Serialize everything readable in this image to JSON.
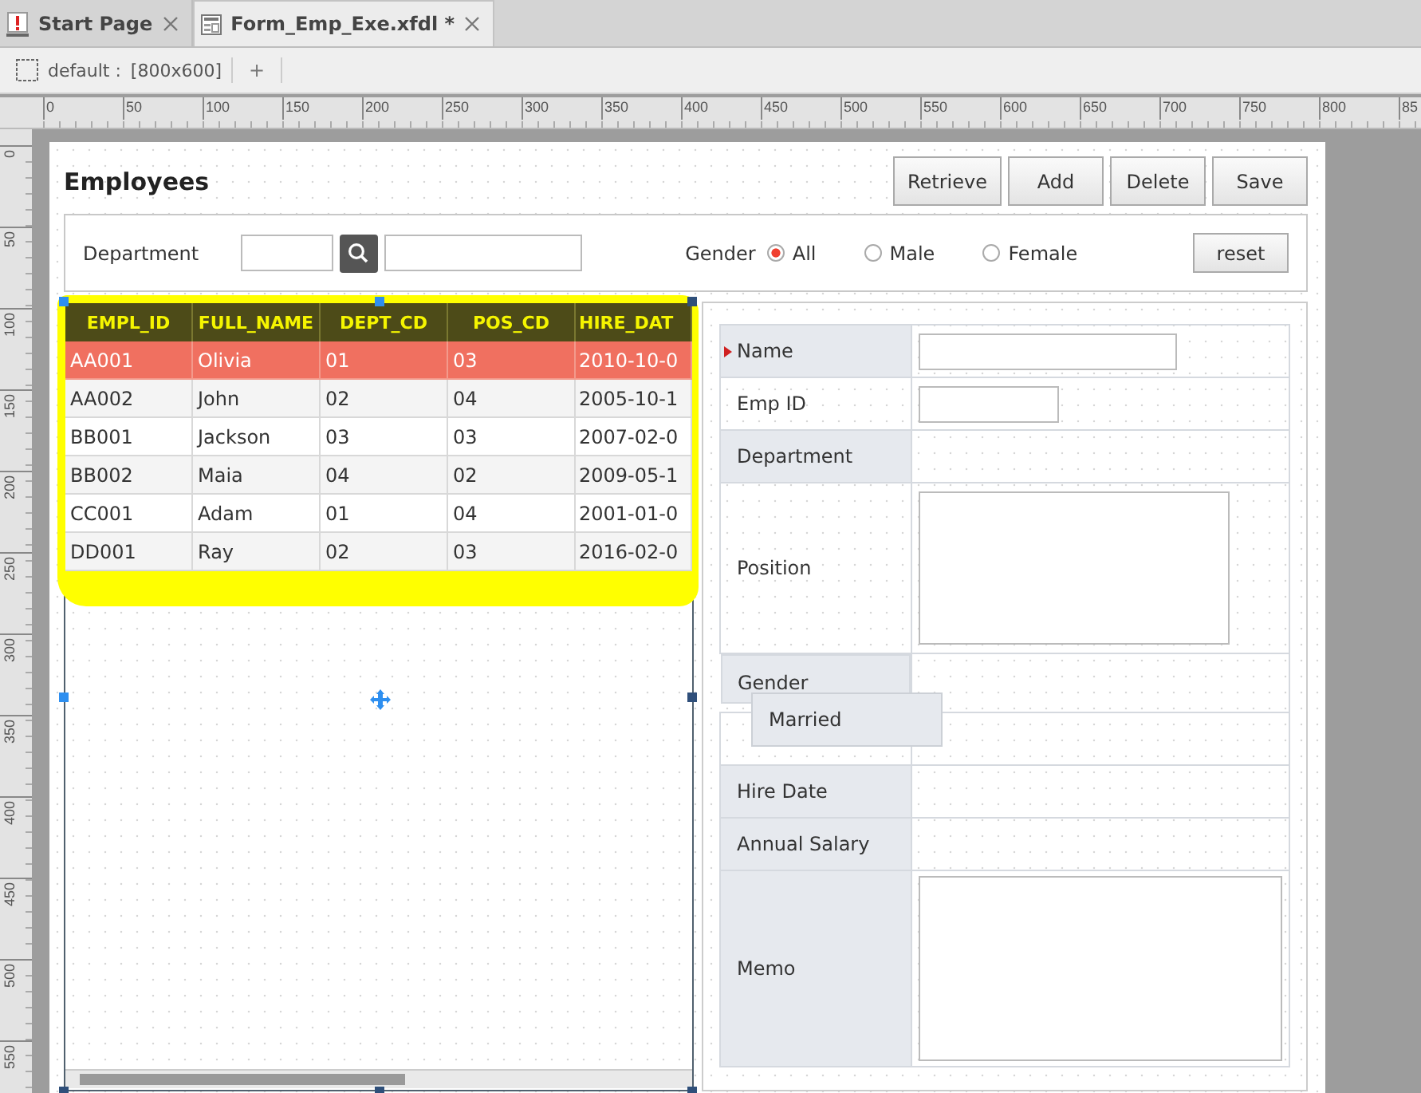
{
  "tabs": [
    {
      "label": "Start Page",
      "selected": false,
      "kind": "start"
    },
    {
      "label": "Form_Emp_Exe.xfdl *",
      "selected": true,
      "kind": "form"
    }
  ],
  "toolbar": {
    "layout_label": "default :",
    "layout_size": "[800x600]",
    "add": "+"
  },
  "rulers": {
    "horizontal": [
      "0",
      "50",
      "100",
      "150",
      "200",
      "250",
      "300",
      "350",
      "400",
      "450",
      "500",
      "550",
      "600",
      "650",
      "700",
      "750",
      "800",
      "85"
    ],
    "vertical": [
      "0",
      "50",
      "100",
      "150",
      "200",
      "250",
      "300",
      "350",
      "400",
      "450",
      "500",
      "550"
    ]
  },
  "form": {
    "title": "Employees",
    "buttons": [
      "Retrieve",
      "Add",
      "Delete",
      "Save"
    ],
    "search": {
      "department_label": "Department",
      "gender_label": "Gender",
      "gender_options": [
        {
          "label": "All",
          "selected": true
        },
        {
          "label": "Male",
          "selected": false
        },
        {
          "label": "Female",
          "selected": false
        }
      ],
      "reset": "reset"
    },
    "grid": {
      "columns": [
        "EMPL_ID",
        "FULL_NAME",
        "DEPT_CD",
        "POS_CD",
        "HIRE_DAT"
      ],
      "rows": [
        {
          "cells": [
            "AA001",
            "Olivia",
            "01",
            "03",
            "2010-10-0"
          ],
          "selected": true
        },
        {
          "cells": [
            "AA002",
            "John",
            "02",
            "04",
            "2005-10-1"
          ],
          "selected": false
        },
        {
          "cells": [
            "BB001",
            "Jackson",
            "03",
            "03",
            "2007-02-0"
          ],
          "selected": false
        },
        {
          "cells": [
            "BB002",
            "Maia",
            "04",
            "02",
            "2009-05-1"
          ],
          "selected": false
        },
        {
          "cells": [
            "CC001",
            "Adam",
            "01",
            "04",
            "2001-01-0"
          ],
          "selected": false
        },
        {
          "cells": [
            "DD001",
            "Ray",
            "02",
            "03",
            "2016-02-0"
          ],
          "selected": false
        }
      ]
    },
    "detail": {
      "rows": [
        {
          "label": "Name",
          "shaded": true,
          "required": true,
          "kind": "input"
        },
        {
          "label": "Emp ID",
          "shaded": false,
          "required": false,
          "kind": "input"
        },
        {
          "label": "Department",
          "shaded": true,
          "required": false,
          "kind": "plain"
        },
        {
          "label": "Position",
          "shaded": false,
          "required": false,
          "kind": "textarea"
        },
        {
          "label": "Gender",
          "shaded": true,
          "required": false,
          "kind": "plain"
        },
        {
          "shaded": false,
          "required": false,
          "kind": "spacer"
        },
        {
          "label": "Hire Date",
          "shaded": true,
          "required": false,
          "kind": "plain"
        },
        {
          "label": "Annual Salary",
          "shaded": true,
          "required": false,
          "kind": "plain"
        },
        {
          "label": "Memo",
          "shaded": true,
          "required": false,
          "kind": "textarea"
        }
      ],
      "overlay_label": "Married"
    }
  }
}
